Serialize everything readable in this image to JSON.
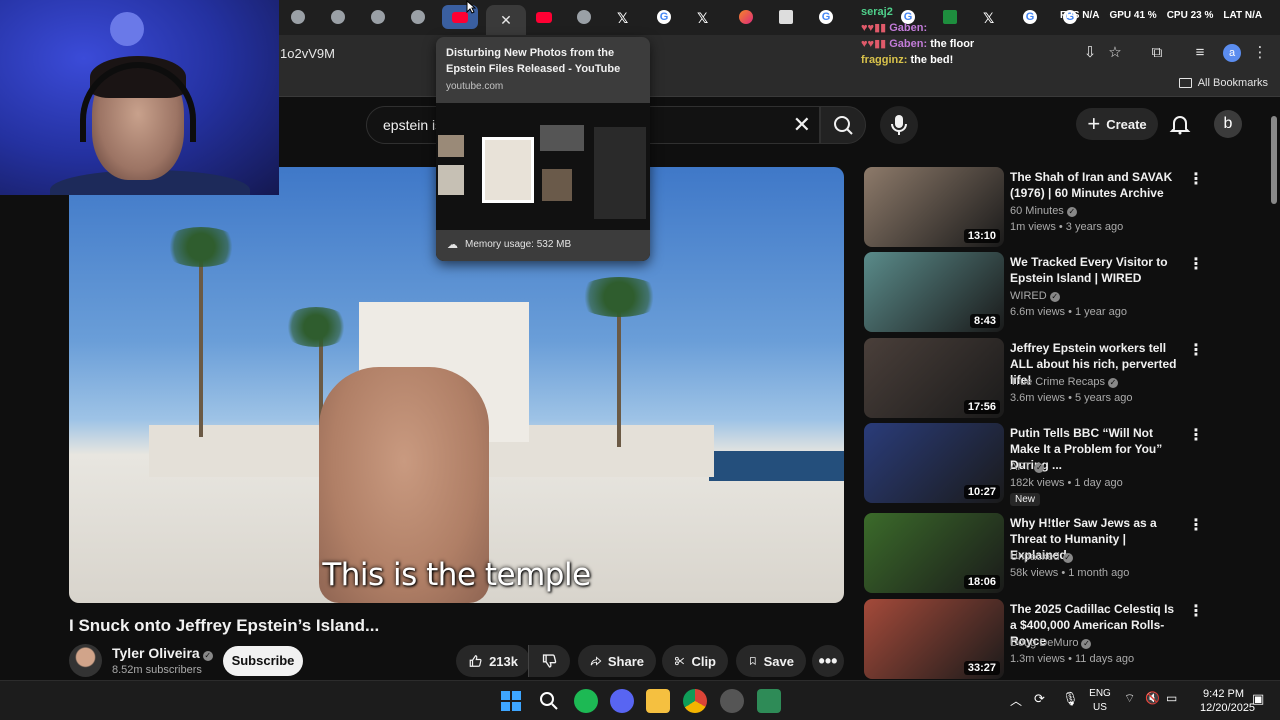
{
  "browser": {
    "url": "1o2vV9M",
    "all_bookmarks_label": "All Bookmarks",
    "tabs": [
      {
        "icon": "chrome-icon"
      },
      {
        "icon": "chrome-icon"
      },
      {
        "icon": "chrome-icon"
      },
      {
        "icon": "chrome-icon"
      },
      {
        "icon": "youtube-icon"
      },
      {
        "icon": "close-icon",
        "active": true
      },
      {
        "icon": "youtube-icon"
      },
      {
        "icon": "chrome-icon"
      },
      {
        "icon": "x-icon"
      },
      {
        "icon": "google-icon"
      },
      {
        "icon": "x-icon"
      },
      {
        "icon": "app-icon"
      },
      {
        "icon": "gov-icon"
      },
      {
        "icon": "google-icon"
      },
      {
        "icon": "google-icon"
      },
      {
        "icon": "google-icon"
      },
      {
        "icon": "sheets-icon"
      },
      {
        "icon": "x-icon"
      },
      {
        "icon": "google-icon"
      },
      {
        "icon": "google-icon"
      }
    ]
  },
  "hw_stats": {
    "fps": "FPS N/A",
    "gpu": "GPU 41 %",
    "cpu": "CPU 23 %",
    "lat": "LAT N/A"
  },
  "tab_preview": {
    "title": "Disturbing New Photos from the Epstein Files Released - YouTube",
    "domain": "youtube.com",
    "memory": "Memory usage: 532 MB"
  },
  "chat": [
    {
      "user": "seraj2",
      "msg": ""
    },
    {
      "user": "Gaben:",
      "msg": ""
    },
    {
      "user": "Gaben:",
      "msg": "the floor"
    },
    {
      "user": "fragginz:",
      "msg": "the bed!"
    }
  ],
  "youtube": {
    "search_query": "epstein is",
    "create_label": "Create",
    "avatar_letter": "b",
    "video": {
      "caption": "This is the temple",
      "title": "I Snuck onto Jeffrey Epstein’s Island...",
      "channel": "Tyler Oliveira",
      "subscribers": "8.52m subscribers",
      "subscribe_label": "Subscribe",
      "likes": "213k",
      "share_label": "Share",
      "clip_label": "Clip",
      "save_label": "Save"
    },
    "recommendations": [
      {
        "title": "The Shah of Iran and SAVAK (1976) | 60 Minutes Archive",
        "channel": "60 Minutes",
        "meta": "1m views • 3 years ago",
        "duration": "13:10",
        "thumb_color": "#8d7a6a"
      },
      {
        "title": "We Tracked Every Visitor to Epstein Island | WIRED",
        "channel": "WIRED",
        "meta": "6.6m views • 1 year ago",
        "duration": "8:43",
        "thumb_color": "#5a8b8a"
      },
      {
        "title": "Jeffrey Epstein workers tell ALL about his rich, perverted life!",
        "channel": "True Crime Recaps",
        "meta": "3.6m views • 5 years ago",
        "duration": "17:56",
        "thumb_color": "#4a3f3a"
      },
      {
        "title": "Putin Tells BBC “Will Not Make It a Problem for You” During ...",
        "channel": "APT",
        "meta": "182k views • 1 day ago",
        "duration": "10:27",
        "thumb_color": "#2a3c7a",
        "badge": "New"
      },
      {
        "title": "Why H!tler Saw Jews as a Threat to Humanity | Explained",
        "channel": "Unpacked",
        "meta": "58k views • 1 month ago",
        "duration": "18:06",
        "thumb_color": "#3b6b2a"
      },
      {
        "title": "The 2025 Cadillac Celestiq Is a $400,000 American Rolls-Royce",
        "channel": "Doug DeMuro",
        "meta": "1.3m views • 11 days ago",
        "duration": "33:27",
        "thumb_color": "#a44a3a"
      }
    ]
  },
  "taskbar": {
    "lang": "ENG",
    "region": "US",
    "time": "9:42 PM",
    "date": "12/20/2025"
  }
}
